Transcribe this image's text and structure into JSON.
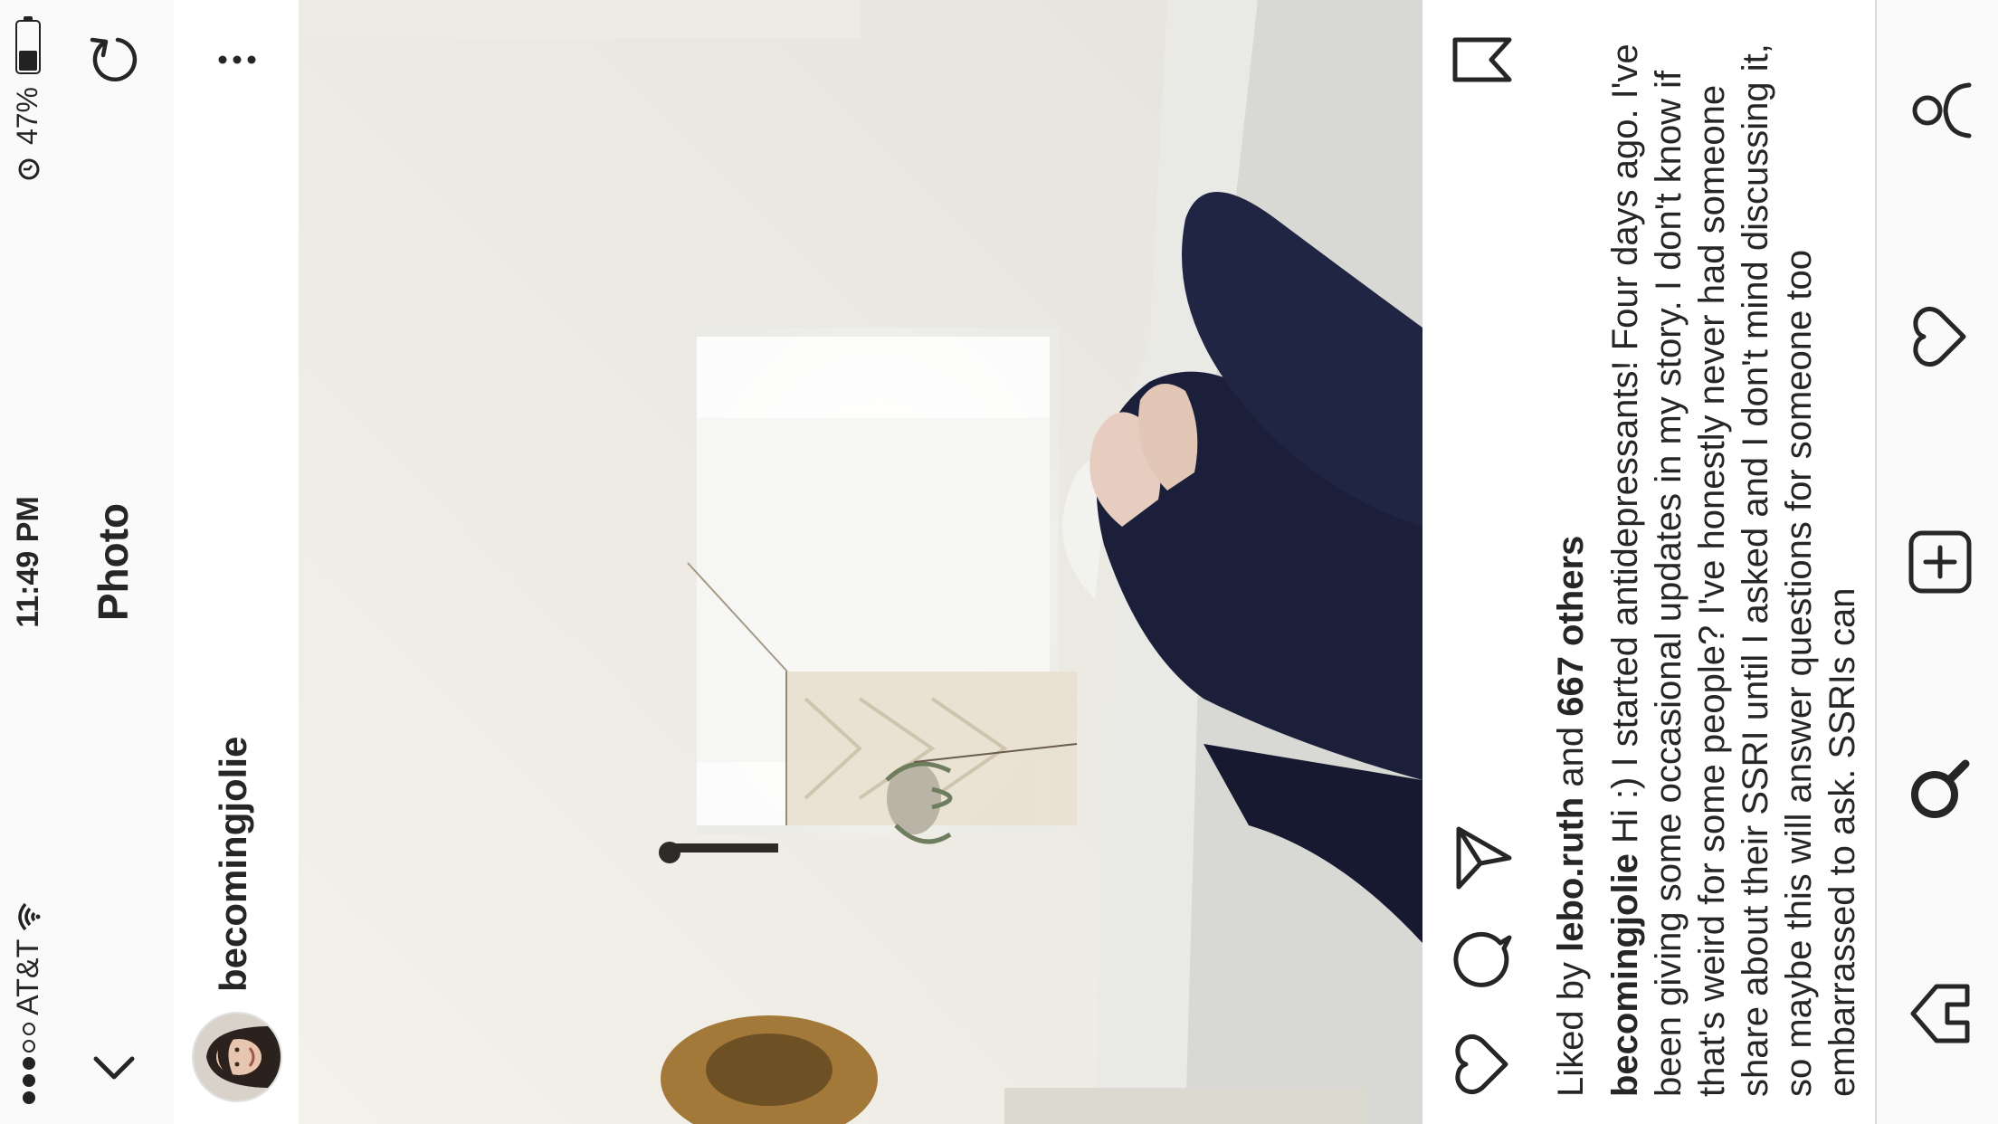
{
  "status_bar": {
    "carrier": "AT&T",
    "time": "11:49 PM",
    "battery": "47%"
  },
  "nav": {
    "title": "Photo"
  },
  "post": {
    "username": "becomingjolie",
    "likes_prefix": "Liked by",
    "liked_by_user": "lebo.ruth",
    "likes_and": "and",
    "likes_others": "667 others",
    "caption_user": "becomingjolie",
    "caption_text": "Hi :) I started antidepressants! Four days ago. I've been giving some occasional updates in my story. I don't know if that's weird for some people? I've honestly never had someone share about their SSRI until I asked and I don't mind discussing it, so maybe this will answer questions for someone too embarrassed to ask. SSRIs can"
  },
  "icons": {
    "back": "chevron-down-icon",
    "refresh": "refresh-icon",
    "more": "more-vertical-icon",
    "like": "heart-icon",
    "comment": "comment-icon",
    "share": "send-icon",
    "save": "bookmark-icon",
    "tab_home": "home-icon",
    "tab_search": "search-icon",
    "tab_add": "add-icon",
    "tab_activity": "heart-icon",
    "tab_profile": "profile-icon"
  },
  "colors": {
    "text": "#262626",
    "bar_bg": "#fafafa",
    "divider": "#dbdbdb"
  }
}
